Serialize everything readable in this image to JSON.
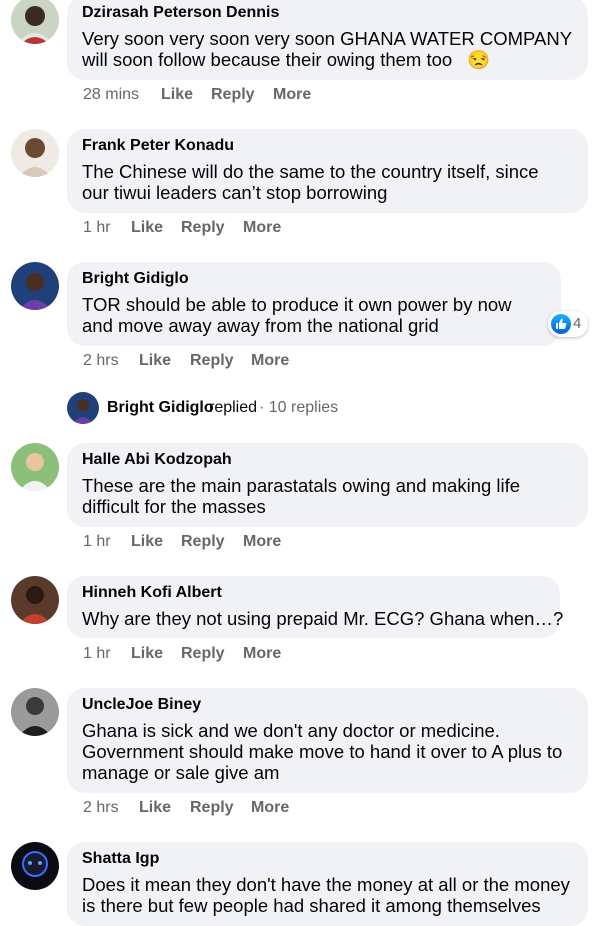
{
  "actions": {
    "like": "Like",
    "reply": "Reply",
    "more": "More"
  },
  "comments": [
    {
      "author": "Dzirasah Peterson Dennis",
      "lines": [
        "Very soon very soon very soon GHANA WATER COMPANY",
        "will soon follow because their owing them too"
      ],
      "emoji": "😒",
      "time": "28 mins"
    },
    {
      "author": "Frank Peter Konadu",
      "lines": [
        "The Chinese will do the same to the country itself, since",
        "our tiwui leaders can’t stop borrowing"
      ],
      "time": "1 hr"
    },
    {
      "author": "Bright Gidiglo",
      "lines": [
        "TOR should be able to produce it own power by now",
        "and move away away from the national grid"
      ],
      "time": "2 hrs",
      "reaction_count": "4"
    },
    {
      "author": "Halle Abi Kodzopah",
      "lines": [
        "These are the main parastatals owing and making life",
        "difficult for the masses"
      ],
      "time": "1 hr"
    },
    {
      "author": "Hinneh Kofi Albert",
      "lines": [
        "Why are they not using prepaid Mr. ECG? Ghana when…?"
      ],
      "time": "1 hr"
    },
    {
      "author": "UncleJoe Biney",
      "lines": [
        "Ghana is sick and we don't any doctor or medicine.",
        "Government should make move to hand it over to A plus to",
        "manage or sale give am"
      ],
      "time": "2 hrs"
    },
    {
      "author": "Shatta Igp",
      "lines": [
        "Does it mean they don't have the money at all or the money",
        "is there but few people had shared it among themselves"
      ]
    }
  ],
  "replies_summary": {
    "author": "Bright Gidiglo",
    "verb": "replied",
    "count": "· 10 replies"
  },
  "colors": {
    "bubble": "#f0f2f5",
    "meta": "#65676b",
    "like_blue": "#1877f2"
  }
}
